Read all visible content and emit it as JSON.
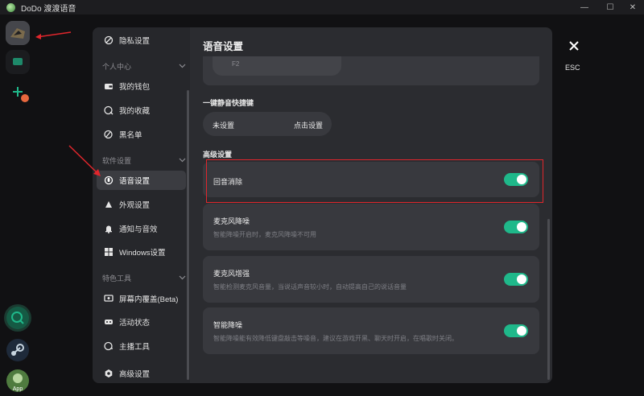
{
  "window": {
    "title": "DoDo 渡渡语音",
    "minimize": "—",
    "maximize": "☐",
    "close": "✕"
  },
  "sidebar": {
    "privacy": "隐私设置",
    "group_personal": "个人中心",
    "wallet": "我的钱包",
    "favorites": "我的收藏",
    "blacklist": "黑名单",
    "group_software": "软件设置",
    "voice": "语音设置",
    "appearance": "外观设置",
    "notification": "通知与音效",
    "windows": "Windows设置",
    "group_special": "特色工具",
    "overlay": "屏幕内覆盖(Beta)",
    "activity": "活动状态",
    "streamer": "主播工具",
    "advanced": "高级设置"
  },
  "main": {
    "title": "语音设置",
    "partial_card_value": "F2",
    "hotkey_section": "一键静音快捷键",
    "hotkey_value": "未设置",
    "hotkey_action": "点击设置",
    "advanced_section": "高级设置",
    "settings": [
      {
        "title": "回音消除",
        "desc": "",
        "enabled": true
      },
      {
        "title": "麦克风降噪",
        "desc": "智能降噪开启时，麦克风降噪不可用",
        "enabled": true
      },
      {
        "title": "麦克风增强",
        "desc": "智能检测麦克风音量，当说话声音较小时，自动提高自己的说话音量",
        "enabled": true
      },
      {
        "title": "智能降噪",
        "desc": "智能降噪能有效降低键盘敲击等噪音，建议在游戏开黑、聊天时开启，在唱歌时关闭。",
        "enabled": true
      }
    ]
  },
  "esc": {
    "label": "ESC"
  },
  "colors": {
    "accent": "#1fb88a",
    "highlight": "#e0262c",
    "arrow": "#e0262c"
  },
  "icons": [
    "shield-icon",
    "wallet-icon",
    "star-icon",
    "block-icon",
    "microphone-icon",
    "palette-icon",
    "bell-icon",
    "windows-icon",
    "overlay-icon",
    "gamepad-icon",
    "streamer-icon",
    "gear-icon",
    "close-icon",
    "chevron-down-icon"
  ]
}
